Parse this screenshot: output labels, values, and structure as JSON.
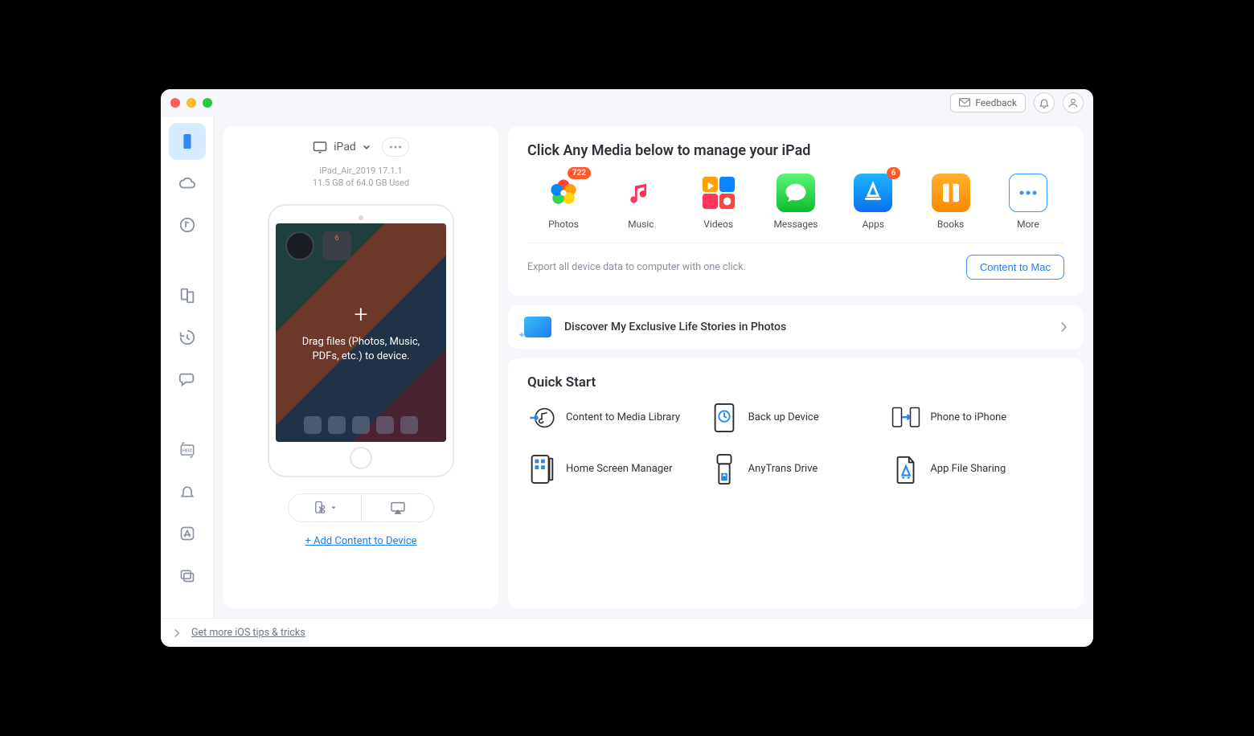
{
  "titlebar": {
    "feedback_label": "Feedback"
  },
  "device": {
    "name": "iPad",
    "model_line": "iPad_Air_2019 17.1.1",
    "storage_line": "11.5 GB of  64.0 GB Used",
    "drag_text": "Drag files (Photos, Music, PDFs, etc.) to device.",
    "add_content_label": "+ Add Content to Device"
  },
  "media": {
    "title": "Click Any Media below to manage your iPad",
    "items": [
      {
        "label": "Photos",
        "badge": "722"
      },
      {
        "label": "Music",
        "badge": null
      },
      {
        "label": "Videos",
        "badge": null
      },
      {
        "label": "Messages",
        "badge": null
      },
      {
        "label": "Apps",
        "badge": "6"
      },
      {
        "label": "Books",
        "badge": null
      },
      {
        "label": "More",
        "badge": null
      }
    ],
    "export_text": "Export all device data to computer with one click.",
    "content_to_mac_label": "Content to Mac"
  },
  "discover": {
    "text": "Discover My Exclusive Life Stories in Photos"
  },
  "quick": {
    "title": "Quick Start",
    "items": [
      "Content to Media Library",
      "Back up Device",
      "Phone to iPhone",
      "Home Screen Manager",
      "AnyTrans Drive",
      "App File Sharing"
    ]
  },
  "footer": {
    "link": "Get more iOS tips & tricks"
  }
}
